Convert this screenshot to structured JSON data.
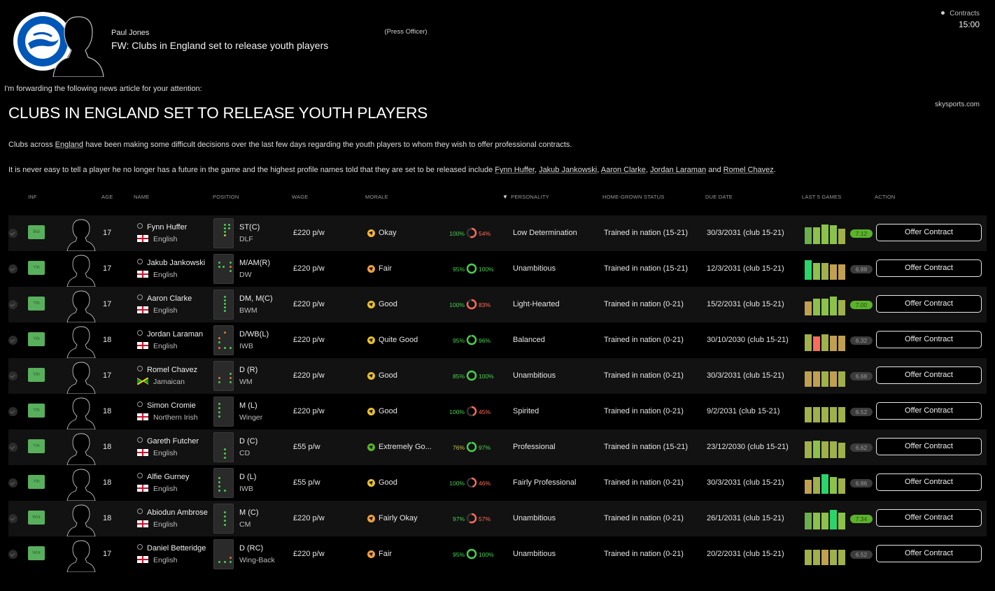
{
  "header": {
    "sender_name": "Paul Jones",
    "sender_role": "(Press Officer)",
    "subject": "FW: Clubs in England set to release youth players",
    "category": "Contracts",
    "time": "15:00",
    "club_badge_icon": "brighton-badge-icon"
  },
  "article": {
    "intro": "I'm forwarding the following news article for your attention:",
    "source": "skysports.com",
    "headline": "CLUBS IN ENGLAND SET TO RELEASE YOUTH PLAYERS",
    "para1_a": "Clubs across ",
    "para1_link": "England",
    "para1_b": " have been making some difficult decisions over the last few days regarding the youth players to whom they wish to offer professional contracts.",
    "para2_a": "It is never easy to tell a player he no longer has a future in the game and the highest profile names told that they are set to be released include ",
    "para2_names": [
      "Fynn Huffer",
      "Jakub Jankowski",
      "Aaron Clarke",
      "Jordan Laraman",
      "Romel Chavez"
    ],
    "para2_sep": ", ",
    "para2_and": " and ",
    "para2_end": "."
  },
  "table": {
    "headers": {
      "inf": "INF",
      "age": "AGE",
      "name": "NAME",
      "position": "POSITION",
      "wage": "WAGE",
      "morale": "MORALE",
      "personality": "PERSONALITY",
      "hg": "HOME-GROWN STATUS",
      "due": "DUE DATE",
      "last5": "LAST 5 GAMES",
      "action": "ACTION"
    },
    "colors": {
      "fitness_high": "#46d04e",
      "fitness_mid": "#c9c24a",
      "condition_low": "#ff6b5a",
      "condition_full": "#46d04e",
      "rating_highlight": "#5ab32a"
    },
    "rows": [
      {
        "tag": "Bid",
        "age": "17",
        "name": "Fynn Huffer",
        "nation": "English",
        "flag": "eng",
        "position": "ST(C)",
        "role": "DLF",
        "wage": "£220 p/w",
        "morale": "Okay",
        "morale_color": "#f5b43a",
        "fitness": "100%",
        "condition": "54%",
        "condition_value": 0.54,
        "personality": "Low Determination",
        "hg": "Trained in nation (15-21)",
        "due": "30/3/2031 (club 15-21)",
        "bars": [
          0.85,
          0.85,
          1.0,
          0.95,
          0.8
        ],
        "bar_colors": [
          "#6ab04c",
          "#8cc24a",
          "#8cc24a",
          "#8cc24a",
          "#a0b04a"
        ],
        "avg": "7.12",
        "avg_hi": true,
        "action": "Offer Contract",
        "pitch": [
          [
            14,
            7,
            "#46d04e"
          ],
          [
            20,
            7,
            "#46d04e"
          ],
          [
            14,
            12,
            "#46d04e"
          ],
          [
            20,
            12,
            "#46d04e"
          ],
          [
            14,
            17,
            "#46d04e"
          ],
          [
            14,
            22,
            "#c9c24a"
          ]
        ]
      },
      {
        "tag": "Yth",
        "age": "17",
        "name": "Jakub Jankowski",
        "nation": "English",
        "flag": "eng",
        "position": "M/AM(R)",
        "role": "DW",
        "wage": "£220 p/w",
        "morale": "Fair",
        "morale_color": "#f0a040",
        "fitness": "95%",
        "condition": "100%",
        "condition_value": 1.0,
        "personality": "Unambitious",
        "hg": "Trained in nation (15-21)",
        "due": "12/3/2031 (club 15-21)",
        "bars": [
          1.0,
          0.85,
          0.85,
          0.8,
          0.8
        ],
        "bar_colors": [
          "#2bd46a",
          "#8cc24a",
          "#a0b04a",
          "#c0a050",
          "#c0a050"
        ],
        "avg": "6.88",
        "avg_hi": false,
        "action": "Offer Contract",
        "pitch": [
          [
            6,
            10,
            "#46d04e"
          ],
          [
            6,
            16,
            "#46d04e"
          ],
          [
            12,
            16,
            "#46d04e"
          ],
          [
            22,
            10,
            "#46d04e"
          ],
          [
            22,
            16,
            "#e07a30"
          ],
          [
            22,
            22,
            "#46d04e"
          ]
        ]
      },
      {
        "tag": "Yth",
        "age": "17",
        "name": "Aaron Clarke",
        "nation": "English",
        "flag": "eng",
        "position": "DM, M(C)",
        "role": "BWM",
        "wage": "£220 p/w",
        "morale": "Good",
        "morale_color": "#e8c02e",
        "fitness": "100%",
        "condition": "83%",
        "condition_value": 0.83,
        "personality": "Light-Hearted",
        "hg": "Trained in nation (0-21)",
        "due": "15/2/2031 (club 15-21)",
        "bars": [
          0.7,
          0.85,
          0.85,
          0.95,
          0.8
        ],
        "bar_colors": [
          "#c0a050",
          "#8cc24a",
          "#8cc24a",
          "#8cc24a",
          "#a0b04a"
        ],
        "avg": "7.00",
        "avg_hi": true,
        "action": "Offer Contract",
        "pitch": [
          [
            14,
            8,
            "#46d04e"
          ],
          [
            14,
            13,
            "#46d04e"
          ],
          [
            14,
            18,
            "#46d04e"
          ],
          [
            14,
            23,
            "#46d04e"
          ],
          [
            14,
            28,
            "#46d04e"
          ]
        ]
      },
      {
        "tag": "Yth",
        "age": "18",
        "name": "Jordan Laraman",
        "nation": "English",
        "flag": "eng",
        "position": "D/WB(L)",
        "role": "IWB",
        "wage": "£220 p/w",
        "morale": "Quite Good",
        "morale_color": "#e8c02e",
        "fitness": "95%",
        "condition": "96%",
        "condition_value": 0.96,
        "personality": "Balanced",
        "hg": "Trained in nation (0-21)",
        "due": "30/10/2030 (club 15-21)",
        "bars": [
          0.85,
          0.75,
          0.85,
          0.8,
          0.8
        ],
        "bar_colors": [
          "#a0b04a",
          "#ff6b5a",
          "#a0b04a",
          "#c0a050",
          "#c0a050"
        ],
        "avg": "6.32",
        "avg_hi": false,
        "action": "Offer Contract",
        "pitch": [
          [
            14,
            8,
            "#e07a30"
          ],
          [
            6,
            16,
            "#e07a30"
          ],
          [
            6,
            22,
            "#46d04e"
          ],
          [
            6,
            30,
            "#e07a30"
          ],
          [
            14,
            30,
            "#46d04e"
          ],
          [
            22,
            30,
            "#46d04e"
          ]
        ]
      },
      {
        "tag": "Yth",
        "age": "17",
        "name": "Romel Chavez",
        "nation": "Jamaican",
        "flag": "jam",
        "position": "D (R)",
        "role": "WM",
        "wage": "£220 p/w",
        "morale": "Good",
        "morale_color": "#e8c02e",
        "fitness": "85%",
        "condition": "100%",
        "condition_value": 1.0,
        "personality": "Unambitious",
        "hg": "Trained in nation (0-21)",
        "due": "30/3/2031 (club 15-21)",
        "bars": [
          0.8,
          0.8,
          0.8,
          0.8,
          0.8
        ],
        "bar_colors": [
          "#c0a050",
          "#c0a050",
          "#a0b04a",
          "#c0a050",
          "#a0b04a"
        ],
        "avg": "6.68",
        "avg_hi": false,
        "action": "Offer Contract",
        "pitch": [
          [
            6,
            22,
            "#e07a30"
          ],
          [
            6,
            28,
            "#46d04e"
          ],
          [
            22,
            16,
            "#46d04e"
          ],
          [
            22,
            22,
            "#e07a30"
          ],
          [
            22,
            28,
            "#46d04e"
          ]
        ]
      },
      {
        "tag": "Yth",
        "age": "18",
        "name": "Simon Cromie",
        "nation": "Northern Irish",
        "flag": "nir",
        "position": "M (L)",
        "role": "Winger",
        "wage": "£220 p/w",
        "morale": "Good",
        "morale_color": "#e8c02e",
        "fitness": "100%",
        "condition": "45%",
        "condition_value": 0.45,
        "personality": "Spirited",
        "hg": "Trained in nation (0-21)",
        "due": "9/2/2031 (club 15-21)",
        "bars": [
          0.8,
          0.8,
          0.8,
          0.8,
          0.8
        ],
        "bar_colors": [
          "#a0b04a",
          "#a0b04a",
          "#a0b04a",
          "#a0b04a",
          "#a0b04a"
        ],
        "avg": "6.52",
        "avg_hi": false,
        "action": "Offer Contract",
        "pitch": [
          [
            6,
            8,
            "#46d04e"
          ],
          [
            6,
            14,
            "#46d04e"
          ],
          [
            6,
            20,
            "#46d04e"
          ],
          [
            6,
            26,
            "#46d04e"
          ]
        ]
      },
      {
        "tag": "Yth",
        "age": "18",
        "name": "Gareth Futcher",
        "nation": "English",
        "flag": "eng",
        "position": "D (C)",
        "role": "CD",
        "wage": "£55 p/w",
        "morale": "Extremely Go...",
        "morale_color": "#5ab32a",
        "fitness": "76%",
        "condition": "97%",
        "condition_value": 0.97,
        "personality": "Professional",
        "hg": "Trained in nation (15-21)",
        "due": "23/12/2030 (club 15-21)",
        "bars": [
          0.85,
          0.9,
          0.85,
          0.85,
          0.8
        ],
        "bar_colors": [
          "#a0b04a",
          "#8cc24a",
          "#a0b04a",
          "#a0b04a",
          "#a0b04a"
        ],
        "avg": "6.62",
        "avg_hi": false,
        "action": "Offer Contract",
        "pitch": [
          [
            14,
            22,
            "#46d04e"
          ],
          [
            14,
            28,
            "#46d04e"
          ],
          [
            14,
            34,
            "#46d04e"
          ]
        ]
      },
      {
        "tag": "Yth",
        "age": "18",
        "name": "Alfie Gurney",
        "nation": "English",
        "flag": "eng",
        "position": "D (L)",
        "role": "IWB",
        "wage": "£55 p/w",
        "morale": "Good",
        "morale_color": "#e8c02e",
        "fitness": "100%",
        "condition": "46%",
        "condition_value": 0.46,
        "personality": "Fairly Professional",
        "hg": "Trained in nation (0-21)",
        "due": "30/3/2031 (club 15-21)",
        "bars": [
          0.7,
          0.85,
          1.0,
          0.85,
          0.8
        ],
        "bar_colors": [
          "#c0a050",
          "#a0b04a",
          "#2bd46a",
          "#8cc24a",
          "#a0b04a"
        ],
        "avg": "6.86",
        "avg_hi": false,
        "action": "Offer Contract",
        "pitch": [
          [
            6,
            12,
            "#46d04e"
          ],
          [
            6,
            18,
            "#46d04e"
          ],
          [
            6,
            24,
            "#46d04e"
          ],
          [
            6,
            30,
            "#46d04e"
          ],
          [
            14,
            30,
            "#46d04e"
          ]
        ]
      },
      {
        "tag": "Wnt",
        "age": "18",
        "name": "Abiodun Ambrose",
        "nation": "English",
        "flag": "eng",
        "position": "M (C)",
        "role": "CM",
        "wage": "£220 p/w",
        "morale": "Fairly Okay",
        "morale_color": "#f0a040",
        "fitness": "97%",
        "condition": "57%",
        "condition_value": 0.57,
        "personality": "Unambitious",
        "hg": "Trained in nation (0-21)",
        "due": "26/1/2031 (club 15-21)",
        "bars": [
          0.85,
          0.85,
          0.85,
          1.0,
          0.85
        ],
        "bar_colors": [
          "#6ab04c",
          "#8cc24a",
          "#8cc24a",
          "#2bd46a",
          "#8cc24a"
        ],
        "avg": "7.34",
        "avg_hi": true,
        "action": "Offer Contract",
        "pitch": [
          [
            14,
            10,
            "#46d04e"
          ],
          [
            14,
            16,
            "#46d04e"
          ],
          [
            14,
            22,
            "#46d04e"
          ],
          [
            14,
            28,
            "#46d04e"
          ]
        ]
      },
      {
        "tag": "Wnt",
        "age": "17",
        "name": "Daniel Betteridge",
        "nation": "English",
        "flag": "eng",
        "position": "D (RC)",
        "role": "Wing-Back",
        "wage": "£220 p/w",
        "morale": "Fair",
        "morale_color": "#f0a040",
        "fitness": "95%",
        "condition": "100%",
        "condition_value": 1.0,
        "personality": "Unambitious",
        "hg": "Trained in nation (0-21)",
        "due": "20/2/2031 (club 15-21)",
        "bars": [
          0.8,
          0.8,
          0.8,
          0.8,
          0.8
        ],
        "bar_colors": [
          "#a0b04a",
          "#a0b04a",
          "#c0a050",
          "#a0b04a",
          "#a0b04a"
        ],
        "avg": "6.52",
        "avg_hi": false,
        "action": "Offer Contract",
        "pitch": [
          [
            6,
            30,
            "#46d04e"
          ],
          [
            14,
            30,
            "#46d04e"
          ],
          [
            22,
            30,
            "#46d04e"
          ],
          [
            22,
            24,
            "#e07a30"
          ]
        ]
      }
    ]
  }
}
